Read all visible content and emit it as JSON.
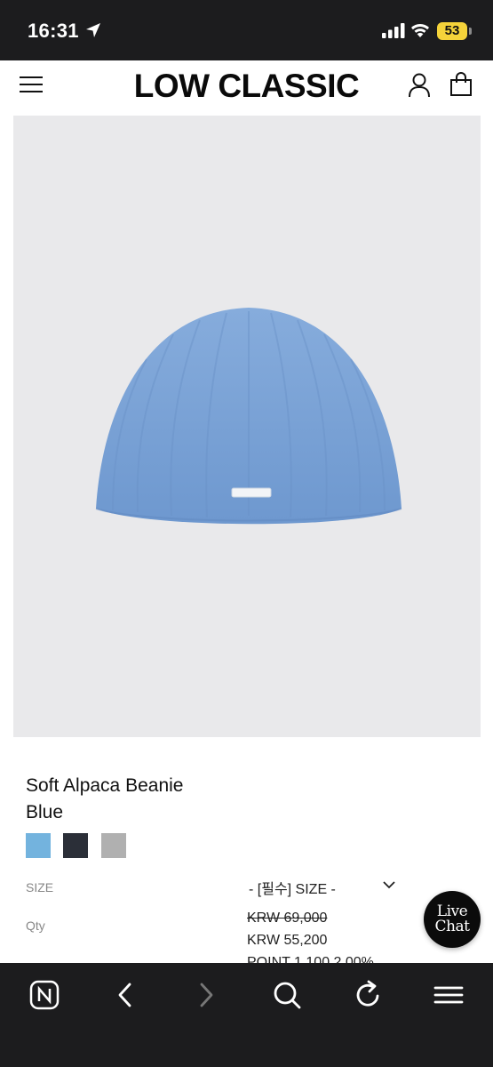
{
  "status_bar": {
    "time": "16:31",
    "battery": "53",
    "battery_color": "#f5d33a"
  },
  "header": {
    "brand": "LOW CLASSIC",
    "menu_icon": "hamburger-menu-icon",
    "account_icon": "user-icon",
    "cart_icon": "shopping-bag-icon"
  },
  "product": {
    "name_line1": "Soft Alpaca Beanie",
    "name_line2": "Blue",
    "image_background": "#e9e9eb",
    "beanie_color": "#7aa3d6",
    "swatches": [
      {
        "name": "blue",
        "color": "#73b3de"
      },
      {
        "name": "navy",
        "color": "#2b2f38"
      },
      {
        "name": "grey",
        "color": "#b0b0b0"
      }
    ]
  },
  "options": {
    "size_label": "SIZE",
    "size_select": "- [필수] SIZE -",
    "qty_label": "Qty"
  },
  "pricing": {
    "original_price": "KRW 69,000",
    "sale_price": "KRW 55,200",
    "points": "POINT 1,100 2.00%"
  },
  "live_chat": {
    "line1": "Live",
    "line2": "Chat"
  },
  "toolbar": {
    "items": [
      "naver-home-icon",
      "back-icon",
      "forward-icon",
      "search-icon",
      "refresh-icon",
      "menu-icon"
    ]
  }
}
